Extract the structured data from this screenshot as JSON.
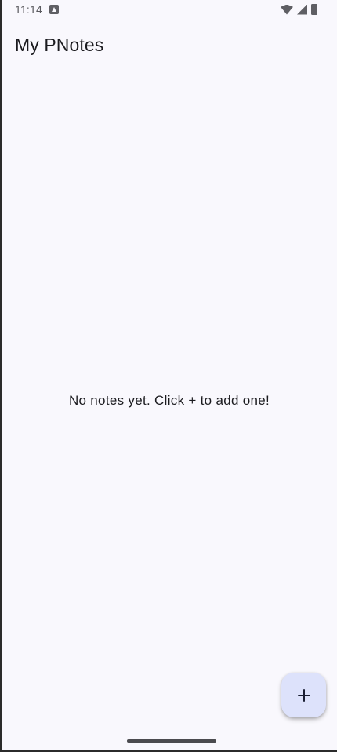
{
  "status_bar": {
    "time": "11:14",
    "icons": [
      "notification-icon",
      "wifi-icon",
      "signal-icon",
      "battery-icon"
    ]
  },
  "app_bar": {
    "title": "My PNotes"
  },
  "main": {
    "empty_message": "No notes yet. Click + to add one!"
  },
  "fab": {
    "icon": "plus-icon",
    "color": "#dde2fb"
  },
  "colors": {
    "background": "#f9f8fd",
    "text": "#1b1b1f"
  }
}
